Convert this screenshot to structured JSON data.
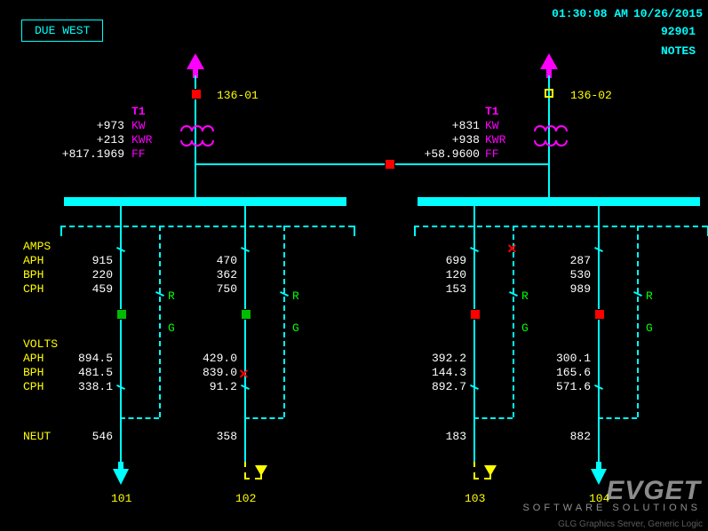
{
  "header": {
    "station": "DUE WEST",
    "time": "01:30:08 AM",
    "date": "10/26/2015",
    "code": "92901",
    "notes": "NOTES"
  },
  "transformers": {
    "left": {
      "id": "T1",
      "switch": "136-01",
      "labels": [
        "KW",
        "KWR",
        "FF"
      ],
      "vals": [
        "+973",
        "+213",
        "+817.1969"
      ]
    },
    "right": {
      "id": "T1",
      "switch": "136-02",
      "labels": [
        "KW",
        "KWR",
        "FF"
      ],
      "vals": [
        "+831",
        "+938",
        "+58.9600"
      ]
    }
  },
  "rowLabels": {
    "amps": "AMPS",
    "aph": "APH",
    "bph": "BPH",
    "cph": "CPH",
    "volts": "VOLTS",
    "neut": "NEUT",
    "r": "R",
    "g": "G"
  },
  "feeders": [
    {
      "out": "101",
      "amps": [
        "915",
        "220",
        "459"
      ],
      "volts": [
        "894.5",
        "481.5",
        "338.1"
      ],
      "neut": "546",
      "sq": "green",
      "xmark": false,
      "dashOut": false,
      "arrowColor": "#0ff"
    },
    {
      "out": "102",
      "amps": [
        "470",
        "362",
        "750"
      ],
      "volts": [
        "429.0",
        "839.0",
        "91.2"
      ],
      "neut": "358",
      "sq": "green",
      "xmark": true,
      "dashOut": true,
      "arrowColor": "#ff0"
    },
    {
      "out": "103",
      "amps": [
        "699",
        "120",
        "153"
      ],
      "volts": [
        "392.2",
        "144.3",
        "892.7"
      ],
      "neut": "183",
      "sq": "red",
      "xmark": true,
      "dashOut": true,
      "arrowColor": "#ff0"
    },
    {
      "out": "104",
      "amps": [
        "287",
        "530",
        "989"
      ],
      "volts": [
        "300.1",
        "165.6",
        "571.6"
      ],
      "neut": "882",
      "sq": "red",
      "xmark": false,
      "dashOut": false,
      "arrowColor": "#0ff"
    }
  ],
  "logo": {
    "name": "EVGET",
    "sub": "SOFTWARE SOLUTIONS"
  },
  "footer": "GLG Graphics Server, Generic Logic"
}
